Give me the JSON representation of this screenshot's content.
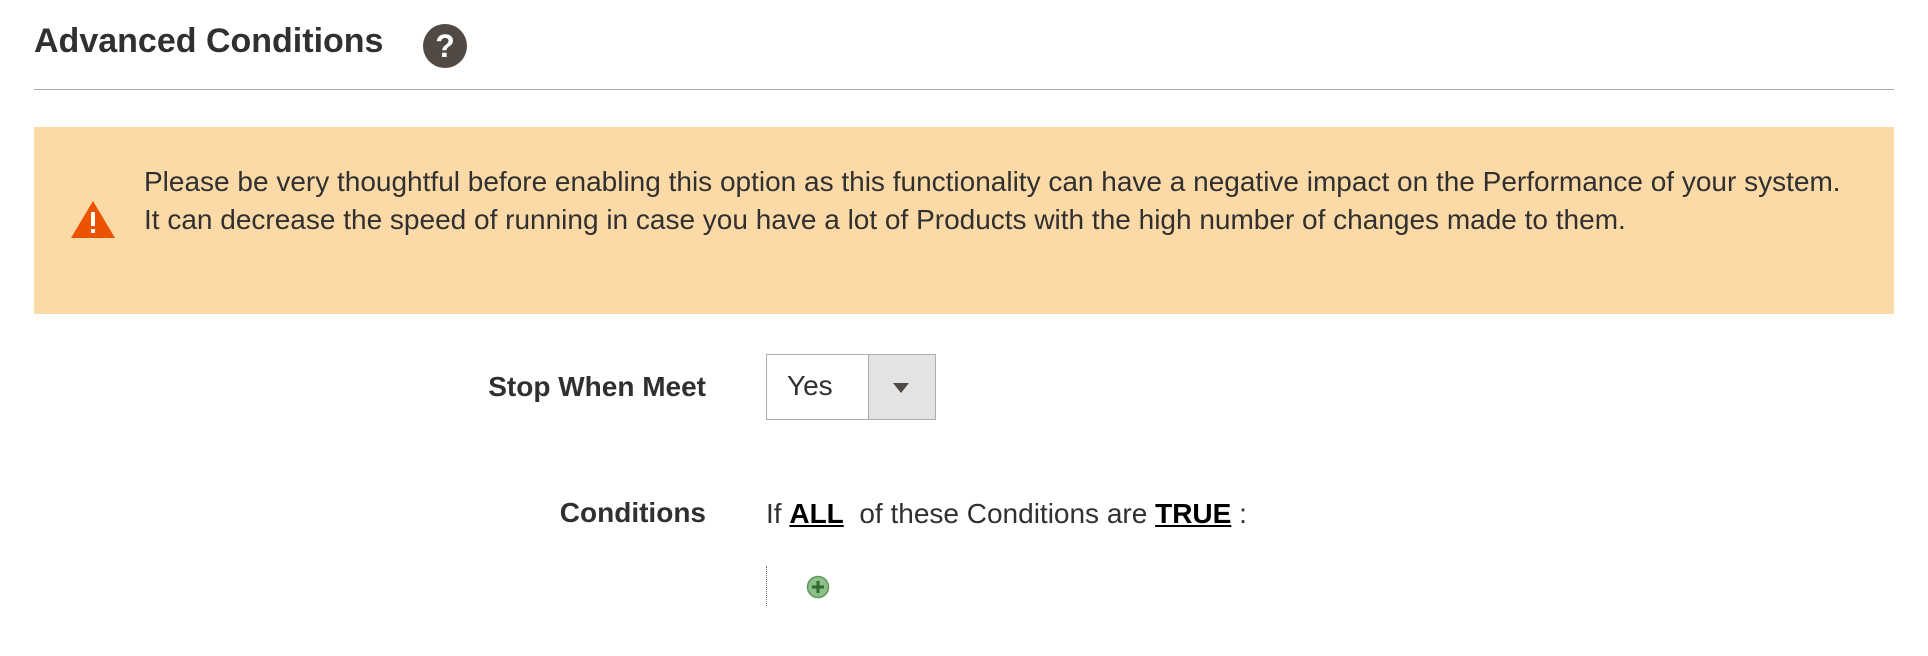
{
  "section": {
    "title": "Advanced Conditions",
    "help_icon": "?"
  },
  "warning": {
    "line1": "Please be very thoughtful before enabling this option as this functionality can have a negative impact on the Performance of your system.",
    "line2": "It can decrease the speed of running in case you have a lot of Products with the high number of changes made to them.",
    "icon": "warning-triangle-icon",
    "background_color": "#fcdaa7",
    "icon_color": "#eb5202"
  },
  "stop_when_meet": {
    "label": "Stop When Meet",
    "selected": "Yes"
  },
  "conditions": {
    "label": "Conditions",
    "prefix": "If",
    "aggregator": "ALL",
    "middle": "of these Conditions are",
    "value": "TRUE",
    "suffix": ":",
    "add_icon": "add-condition-icon"
  }
}
